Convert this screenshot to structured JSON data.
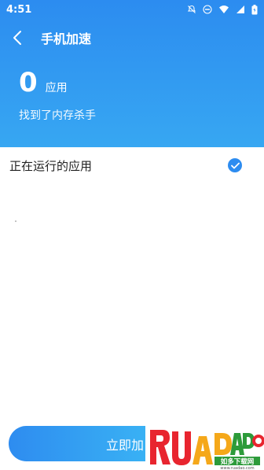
{
  "status_bar": {
    "time": "4:51",
    "icons": [
      "bell-off-icon",
      "do-not-disturb-icon",
      "wifi-icon",
      "signal-icon",
      "battery-charging-icon"
    ]
  },
  "appbar": {
    "title": "手机加速",
    "back_icon": "back-arrow-icon"
  },
  "summary": {
    "count": "0",
    "unit": "应用",
    "subtitle": "找到了内存杀手"
  },
  "list": {
    "header_label": "正在运行的应用",
    "select_all_checked": true
  },
  "action": {
    "button_label": "立即加"
  },
  "watermark": {
    "brand": "RUANDADO",
    "tagline": "如多下载网",
    "url": "www.ruadao.com"
  },
  "colors": {
    "primary": "#2d8cf0",
    "header_top": "#2c8cf0",
    "header_bottom": "#37a7f2"
  }
}
